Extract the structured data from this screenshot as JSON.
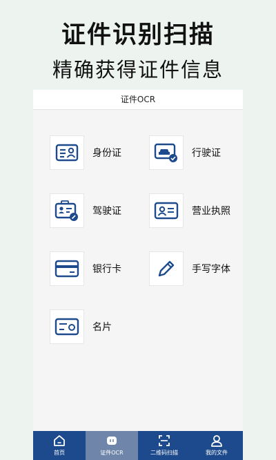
{
  "promo": {
    "title": "证件识别扫描",
    "subtitle": "精确获得证件信息"
  },
  "app": {
    "header_title": "证件OCR"
  },
  "grid": {
    "items": [
      {
        "label": "身份证",
        "icon": "id-card-icon"
      },
      {
        "label": "行驶证",
        "icon": "vehicle-license-icon"
      },
      {
        "label": "驾驶证",
        "icon": "driver-license-icon"
      },
      {
        "label": "营业执照",
        "icon": "business-license-icon"
      },
      {
        "label": "银行卡",
        "icon": "bank-card-icon"
      },
      {
        "label": "手写字体",
        "icon": "pen-icon"
      },
      {
        "label": "名片",
        "icon": "business-card-icon"
      }
    ]
  },
  "tabbar": {
    "active_index": 1,
    "tabs": [
      {
        "label": "首页",
        "icon": "home-icon"
      },
      {
        "label": "证件OCR",
        "icon": "ocr-icon"
      },
      {
        "label": "二维码扫描",
        "icon": "qr-scan-icon"
      },
      {
        "label": "我的文件",
        "icon": "user-icon"
      }
    ]
  },
  "colors": {
    "accent": "#1d4a8c",
    "active_tab": "#6f86aa",
    "background": "#edf3ee"
  }
}
